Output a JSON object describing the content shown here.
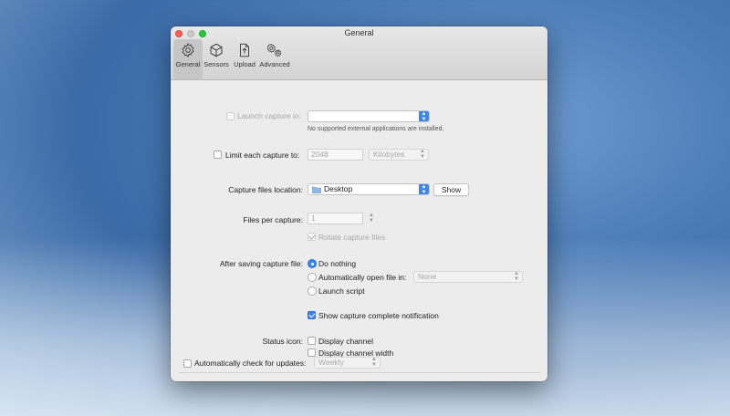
{
  "window": {
    "title": "General"
  },
  "toolbar": {
    "items": [
      {
        "label": "General",
        "icon": "gear-icon",
        "selected": true
      },
      {
        "label": "Sensors",
        "icon": "cube-icon"
      },
      {
        "label": "Upload",
        "icon": "upload-icon"
      },
      {
        "label": "Advanced",
        "icon": "gears-icon"
      }
    ]
  },
  "launch_capture": {
    "label": "Launch capture in:",
    "value": "",
    "note": "No supported external applications are installed."
  },
  "limit_capture": {
    "label": "Limit each capture to:",
    "value": "2048",
    "unit": "Kilobytes"
  },
  "location": {
    "label": "Capture files location:",
    "value": "Desktop",
    "show_button": "Show"
  },
  "files_per_capture": {
    "label": "Files per capture:",
    "value": "1",
    "rotate_label": "Rotate capture files"
  },
  "after_saving": {
    "label": "After saving capture file:",
    "options": [
      "Do nothing",
      "Automatically open file in:",
      "Launch script"
    ],
    "open_in_value": "None"
  },
  "notification": {
    "label": "Show capture complete notification",
    "checked": true
  },
  "status_icon": {
    "label": "Status icon:",
    "options": [
      "Display channel",
      "Display channel width"
    ]
  },
  "updates": {
    "label": "Automatically check for updates:",
    "frequency": "Weekly"
  },
  "colors": {
    "accent": "#3b86f7",
    "close": "#fe5f57",
    "maximize": "#28c940"
  }
}
